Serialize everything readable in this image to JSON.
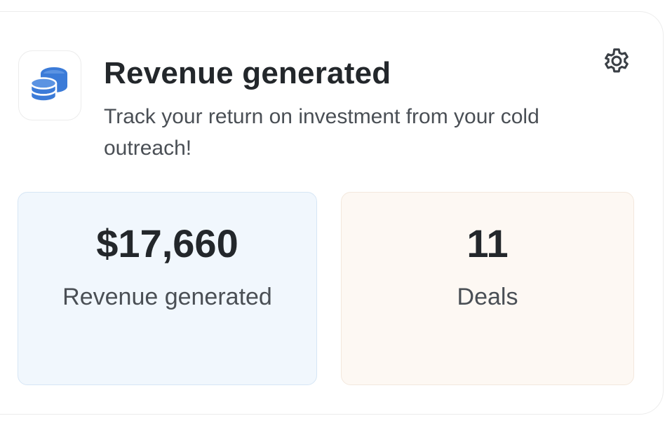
{
  "header": {
    "icon": "coins-stack-icon",
    "title": "Revenue generated",
    "subtitle": "Track your return on investment from your cold outreach!",
    "settings_icon": "gear-icon"
  },
  "stats": [
    {
      "value": "$17,660",
      "label": "Revenue generated"
    },
    {
      "value": "11",
      "label": "Deals"
    }
  ],
  "colors": {
    "accent_blue": "#3b7bd8",
    "revenue_tile_bg": "#f1f7fd",
    "deals_tile_bg": "#fdf8f3"
  }
}
